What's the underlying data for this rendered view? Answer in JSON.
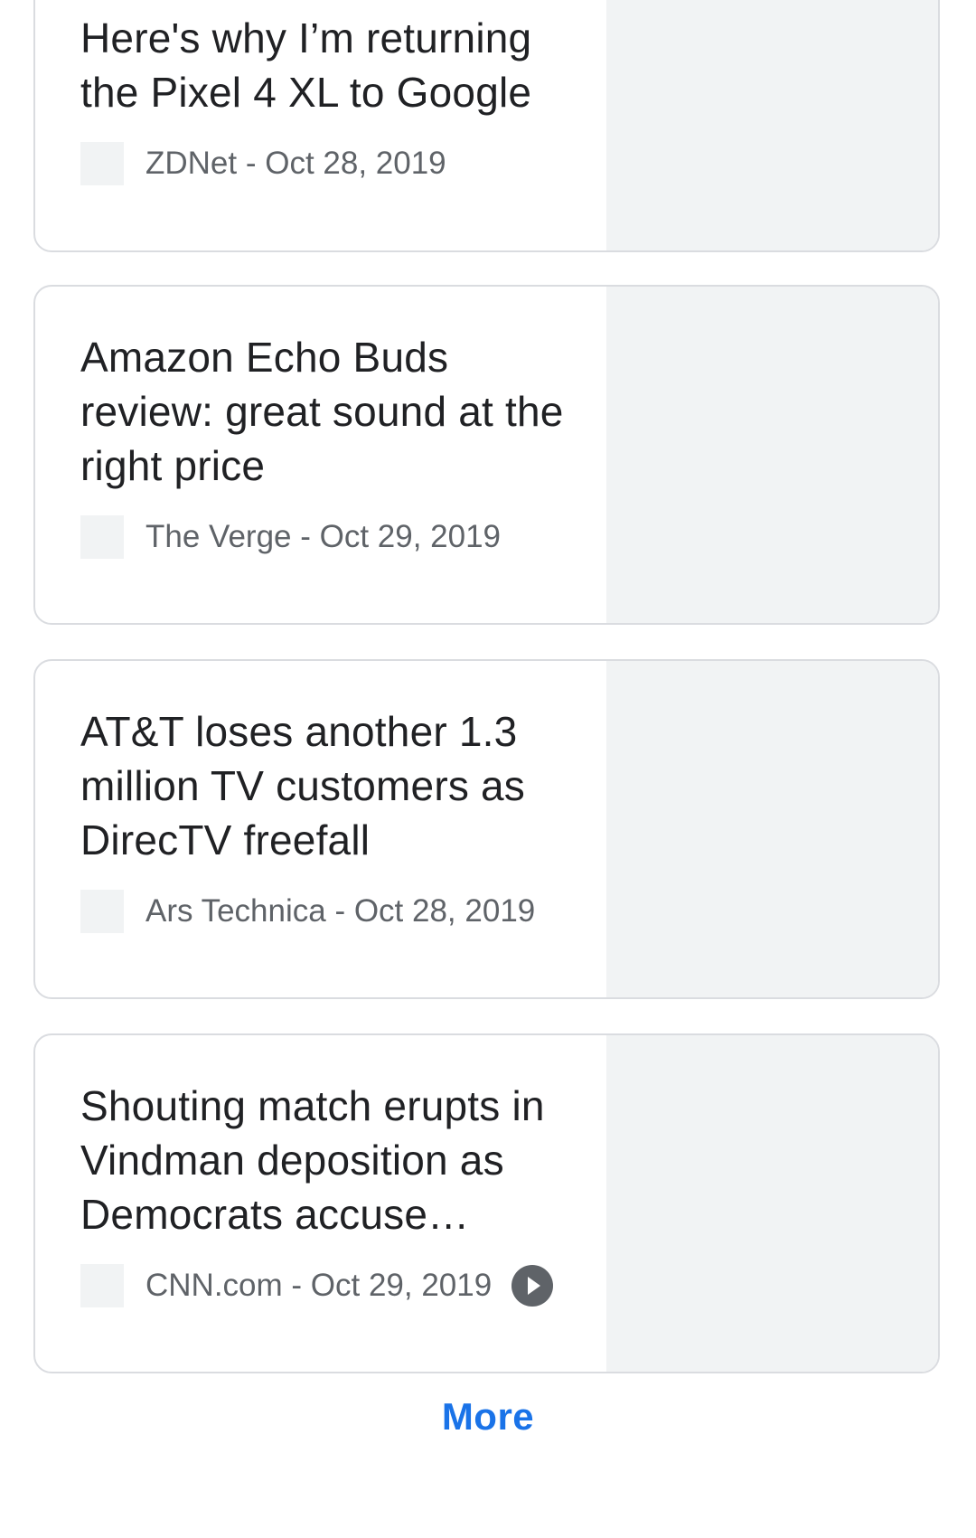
{
  "articles": [
    {
      "headline": "Here's why I’m returning the Pixel 4 XL to Google",
      "source": "ZDNet - Oct 28, 2019",
      "has_video": false
    },
    {
      "headline": "Amazon Echo Buds review: great sound at the right price",
      "source": "The Verge - Oct 29, 2019",
      "has_video": false
    },
    {
      "headline": "AT&T loses another 1.3 million TV customers as DirecTV freefall",
      "source": "Ars Technica - Oct 28, 2019",
      "has_video": false
    },
    {
      "headline": "Shouting match erupts in Vindman deposition as Democrats accuse…",
      "source": "CNN.com - Oct 29, 2019",
      "has_video": true,
      "video_icon": "play-icon"
    }
  ],
  "more_label": "More",
  "colors": {
    "accent": "#1a73e8",
    "headline": "#202124",
    "meta": "#5f6368",
    "thumbnail_placeholder": "#f1f3f4",
    "card_border": "#dadce0"
  }
}
